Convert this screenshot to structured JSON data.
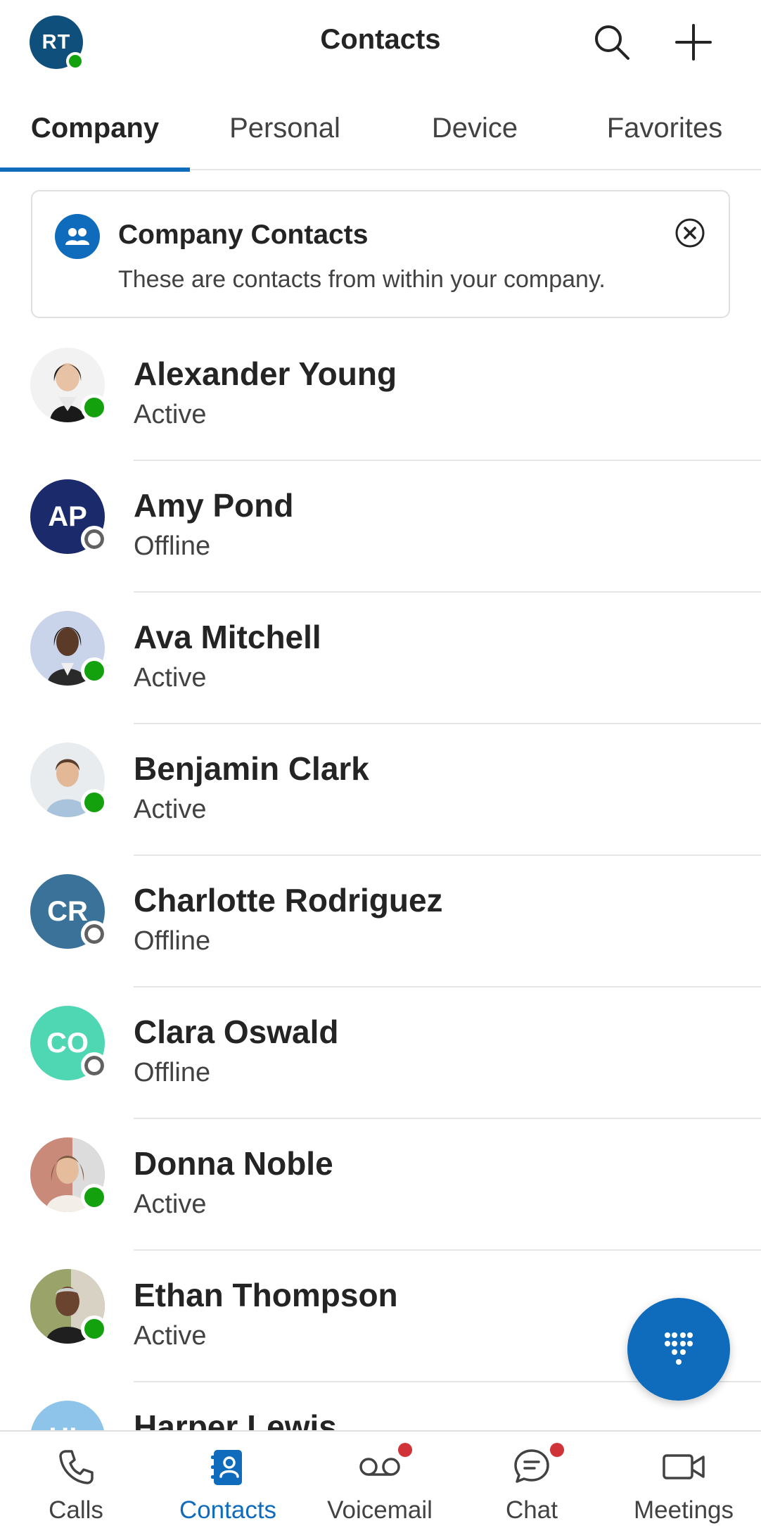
{
  "header": {
    "user_initials": "RT",
    "user_presence": "active",
    "title": "Contacts",
    "search_icon": "search-icon",
    "add_icon": "add-icon"
  },
  "tabs": [
    {
      "label": "Company",
      "active": true
    },
    {
      "label": "Personal",
      "active": false
    },
    {
      "label": "Device",
      "active": false
    },
    {
      "label": "Favorites",
      "active": false
    }
  ],
  "banner": {
    "icon": "people-icon",
    "title": "Company Contacts",
    "text": "These are contacts from within your company.",
    "close_icon": "dismiss-circle-icon"
  },
  "contacts": [
    {
      "name": "Alexander Young",
      "status": "Active",
      "avatar_type": "photo"
    },
    {
      "name": "Amy Pond",
      "status": "Offline",
      "avatar_type": "initials",
      "initials": "AP",
      "avatar_color": "#1b2a6b"
    },
    {
      "name": "Ava Mitchell",
      "status": "Active",
      "avatar_type": "photo"
    },
    {
      "name": "Benjamin Clark",
      "status": "Active",
      "avatar_type": "photo"
    },
    {
      "name": "Charlotte Rodriguez",
      "status": "Offline",
      "avatar_type": "initials",
      "initials": "CR",
      "avatar_color": "#3a7299"
    },
    {
      "name": "Clara Oswald",
      "status": "Offline",
      "avatar_type": "initials",
      "initials": "CO",
      "avatar_color": "#4fd6b2"
    },
    {
      "name": "Donna Noble",
      "status": "Active",
      "avatar_type": "photo"
    },
    {
      "name": "Ethan Thompson",
      "status": "Active",
      "avatar_type": "photo"
    },
    {
      "name": "Harper Lewis",
      "status": "",
      "avatar_type": "initials",
      "initials": "HL",
      "avatar_color": "#8fc4ea"
    }
  ],
  "fab": {
    "icon": "dialpad-icon"
  },
  "bottom_nav": [
    {
      "label": "Calls",
      "icon": "phone-icon",
      "active": false,
      "badge": false
    },
    {
      "label": "Contacts",
      "icon": "contact-card-icon",
      "active": true,
      "badge": false
    },
    {
      "label": "Voicemail",
      "icon": "voicemail-icon",
      "active": false,
      "badge": true
    },
    {
      "label": "Chat",
      "icon": "chat-icon",
      "active": false,
      "badge": true
    },
    {
      "label": "Meetings",
      "icon": "video-icon",
      "active": false,
      "badge": false
    }
  ],
  "colors": {
    "accent": "#0f6cbd",
    "presence_active": "#13a10e",
    "badge": "#d13438"
  }
}
